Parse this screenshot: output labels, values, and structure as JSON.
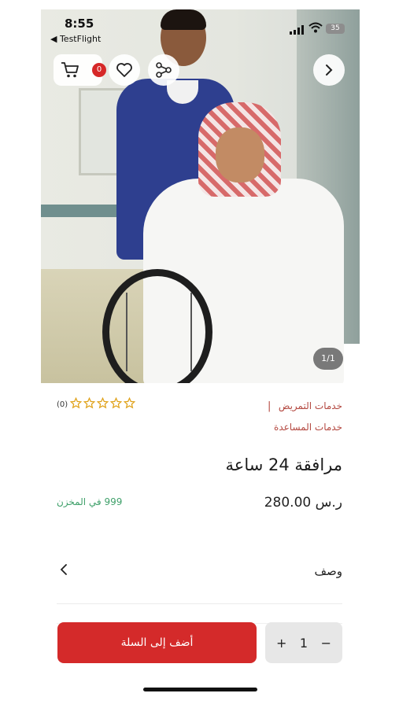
{
  "status_bar": {
    "time": "8:55",
    "back_app": "◀ TestFlight",
    "battery": "35"
  },
  "gallery": {
    "counter": "1/1"
  },
  "toolbar": {
    "cart_count": "0"
  },
  "icons": {
    "cart": "cart-icon",
    "heart": "heart-icon",
    "share": "share-icon",
    "next": "chevron-right-icon",
    "star": "star-icon"
  },
  "product": {
    "category_primary": "خدمات التمريض",
    "category_secondary": "خدمات المساعدة",
    "separator": "|",
    "rating_count": "(0)",
    "title": "مرافقة 24 ساعة",
    "price": "ر.س 280.00",
    "stock": "999 في المخزن"
  },
  "description": {
    "label": "وصف"
  },
  "actions": {
    "add_to_cart": "أضف إلى السلة",
    "quantity": "1",
    "plus": "+",
    "minus": "−"
  },
  "colors": {
    "accent": "#d42a2a",
    "category": "#b3473f",
    "stock": "#3fa06a",
    "star": "#e0a21a"
  }
}
